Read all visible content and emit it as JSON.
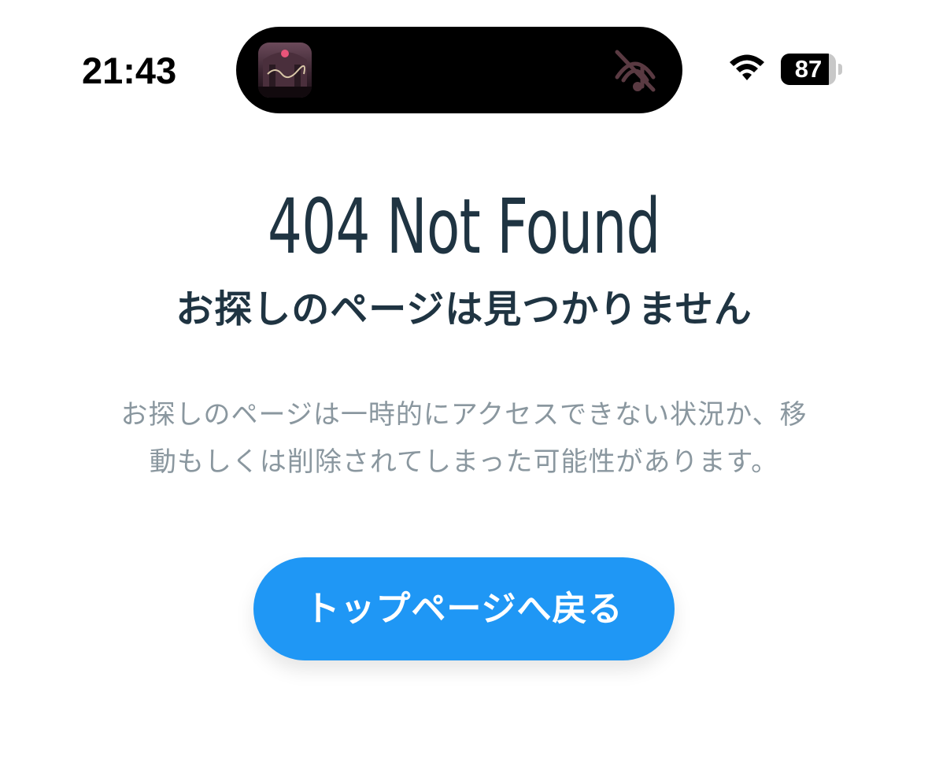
{
  "status_bar": {
    "time": "21:43",
    "battery_level": 87,
    "battery_label": "87",
    "icons": [
      "app-thumbnail-icon",
      "bell-slash-icon",
      "wifi-icon",
      "battery-icon"
    ]
  },
  "error": {
    "title": "404 Not Found",
    "subtitle": "お探しのページは見つかりません",
    "description_lines": [
      "お探しのページは一時的にアクセスできない状況か、移",
      "動もしくは削除されてしまった可能性があります。"
    ]
  },
  "actions": {
    "back_to_top_label": "トップページへ戻る"
  },
  "colors": {
    "heading": "#1f3442",
    "body_text": "#8a979f",
    "button": "#1f97f5",
    "button_text": "#ffffff",
    "background": "#ffffff"
  }
}
